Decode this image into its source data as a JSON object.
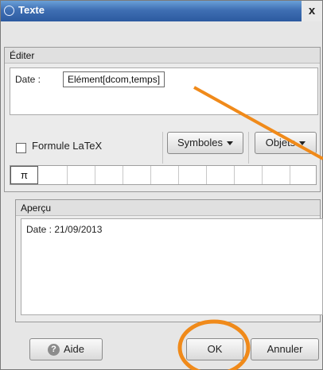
{
  "window": {
    "title": "Texte",
    "close_symbol": "x"
  },
  "edit_panel": {
    "header": "Éditer",
    "date_label": "Date :",
    "object_text": "Elément[dcom,temps]"
  },
  "toolbar": {
    "latex_label": "Formule LaTeX",
    "latex_checked": false,
    "symbols_label": "Symboles",
    "objects_label": "Objets"
  },
  "symbols": [
    "π",
    "",
    "",
    "",
    "",
    "",
    "",
    "",
    "",
    ""
  ],
  "preview_panel": {
    "header": "Aperçu",
    "text": "Date : 21/09/2013"
  },
  "buttons": {
    "help": "Aide",
    "ok": "OK",
    "cancel": "Annuler"
  },
  "icons": {
    "title": "circle-icon",
    "help": "question-mark-icon",
    "dropdown": "caret-down-icon"
  },
  "colors": {
    "titlebar": "#3f6fb3",
    "annotation": "#f08a1a"
  }
}
